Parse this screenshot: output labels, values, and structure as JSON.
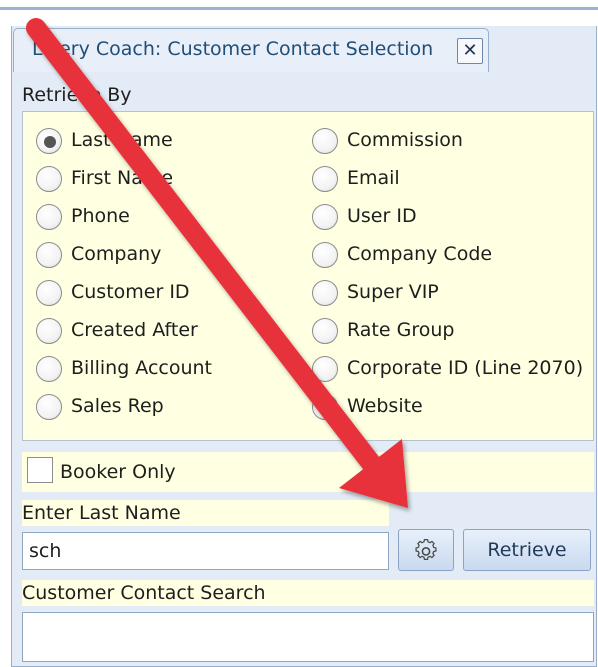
{
  "tab": {
    "title": "Livery Coach: Customer Contact Selection",
    "close_glyph": "✕"
  },
  "retrieve_by": {
    "label": "Retrieve By",
    "options_left": [
      "Last Name",
      "First Name",
      "Phone",
      "Company",
      "Customer ID",
      "Created After",
      "Billing Account",
      "Sales Rep"
    ],
    "options_right": [
      "Commission",
      "Email",
      "User ID",
      "Company Code",
      "Super VIP",
      "Rate Group",
      "Corporate ID (Line 2070)",
      "Website"
    ],
    "selected": "Last Name"
  },
  "booker_only": {
    "label": "Booker Only",
    "checked": false
  },
  "search": {
    "label": "Enter Last Name",
    "value": "sch",
    "gear_icon": "gear-icon",
    "retrieve_label": "Retrieve"
  },
  "results": {
    "label": "Customer Contact Search"
  },
  "colors": {
    "highlight_yellow": "#ffffe1",
    "panel_blue": "#e3ebf6",
    "arrow_red": "#e8333a"
  }
}
